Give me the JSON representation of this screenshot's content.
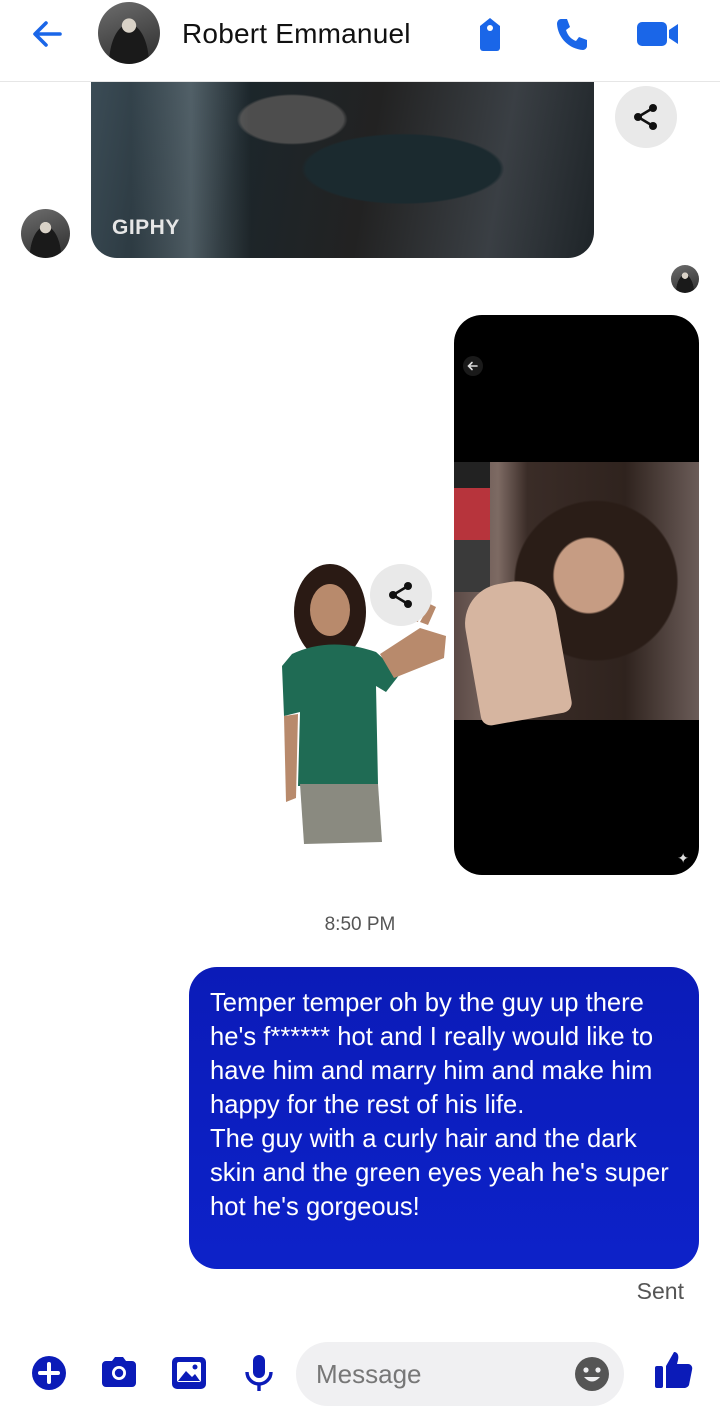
{
  "header": {
    "contact_name": "Robert Emmanuel",
    "icons": [
      "back-arrow-icon",
      "tag-icon",
      "phone-call-icon",
      "video-call-icon"
    ]
  },
  "messages": {
    "gif": {
      "label": "GIPHY"
    },
    "timestamp": "8:50 PM",
    "sent_text": [
      "Temper temper oh by the guy up there he's f****** hot and I really would like to have him and marry him and make him happy for the rest of his life.",
      "The guy with a curly hair and the dark skin and the green eyes yeah he's super hot he's gorgeous!"
    ],
    "status": "Sent"
  },
  "composer": {
    "placeholder": "Message",
    "icons": [
      "plus-icon",
      "camera-icon",
      "gallery-icon",
      "microphone-icon",
      "emoji-icon",
      "thumbs-up-icon"
    ]
  },
  "colors": {
    "accent": "#0a3ff7",
    "bubble": "#0b1bb8",
    "icon_blue": "#1a4de0"
  }
}
